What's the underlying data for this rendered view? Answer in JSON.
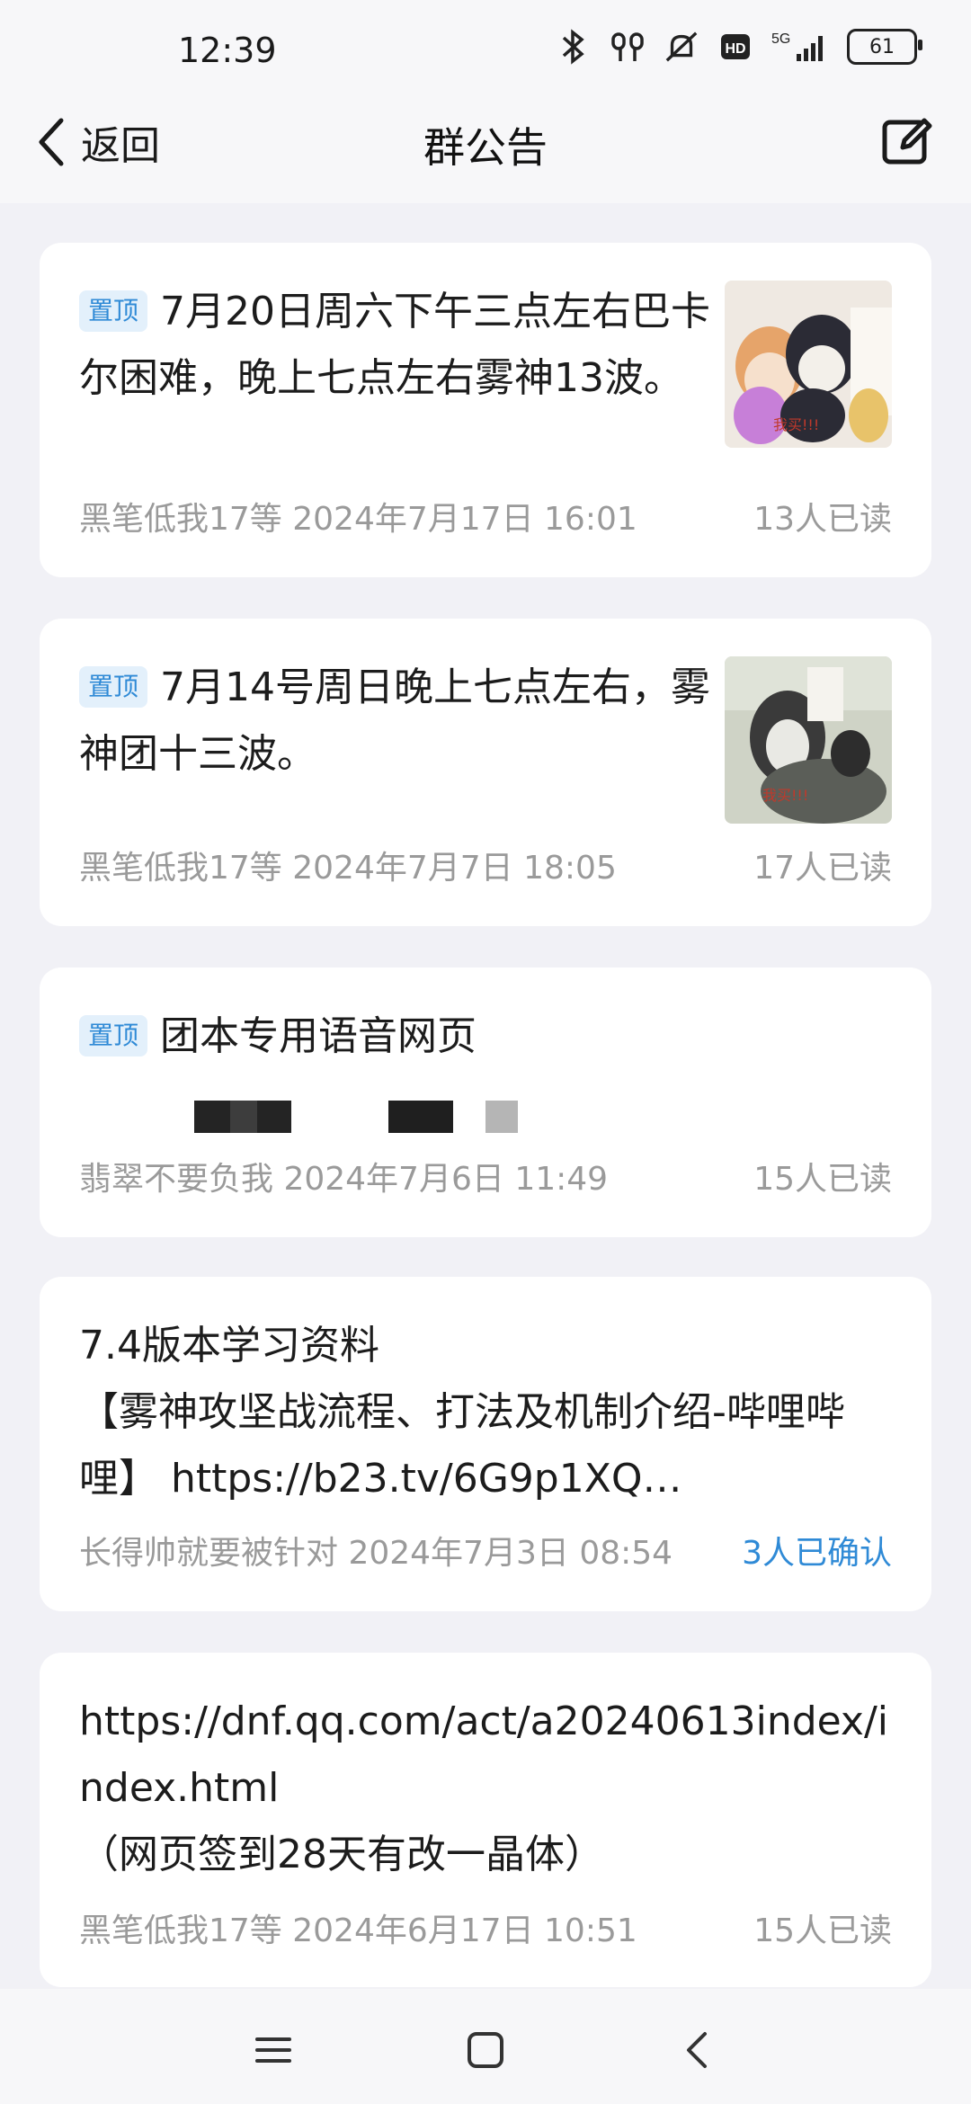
{
  "status_bar": {
    "time": "12:39",
    "battery": "61",
    "network": "5G"
  },
  "header": {
    "back_label": "返回",
    "title": "群公告"
  },
  "announcements": [
    {
      "pinned": true,
      "pin_label": "置顶",
      "text": "7月20日周六下午三点左右巴卡尔困难，晚上七点左右雾神13波。",
      "author_date": "黑笔低我17等 2024年7月17日 16:01",
      "reads": "13人已读",
      "thumbnail": "penguin-meme-1"
    },
    {
      "pinned": true,
      "pin_label": "置顶",
      "text": "7月14号周日晚上七点左右，雾神团十三波。",
      "author_date": "黑笔低我17等 2024年7月7日 18:05",
      "reads": "17人已读",
      "thumbnail": "penguin-meme-2"
    },
    {
      "pinned": true,
      "pin_label": "置顶",
      "text": "团本专用语音网页",
      "author_date": "翡翠不要负我 2024年7月6日 11:49",
      "reads": "15人已读"
    },
    {
      "pinned": false,
      "line1": "7.4版本学习资料",
      "line2": "【雾神攻坚战流程、打法及机制介绍-哔哩哔哩】 https://b23.tv/6G9p1XQ…",
      "author_date": "长得帅就要被针对 2024年7月3日 08:54",
      "reads": "3人已确认"
    },
    {
      "pinned": false,
      "line1": " https://dnf.qq.com/act/a20240613index/index.html",
      "line2": "（网页签到28天有改一晶体）",
      "author_date": "黑笔低我17等 2024年6月17日 10:51",
      "reads": "15人已读"
    }
  ],
  "colors": {
    "accent": "#2f8ad6",
    "background": "#f1f1f6",
    "card": "#ffffff"
  }
}
